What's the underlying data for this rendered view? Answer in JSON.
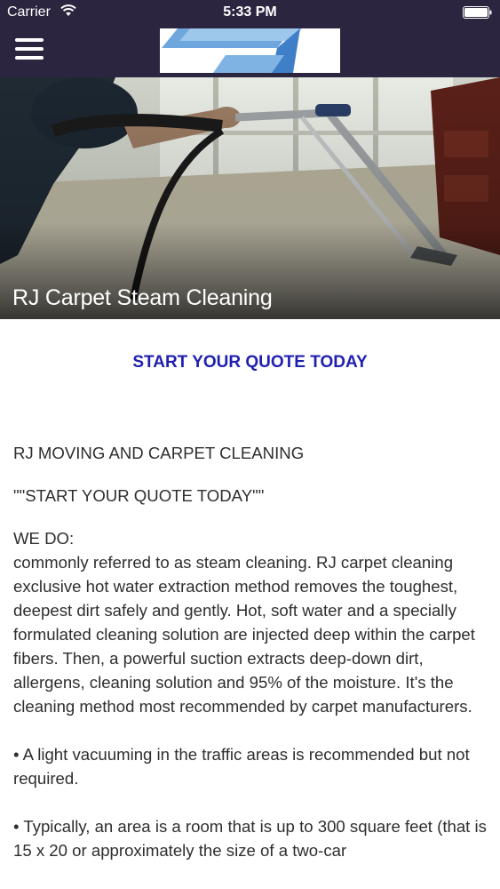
{
  "status_bar": {
    "carrier": "Carrier",
    "time": "5:33 PM"
  },
  "header": {
    "menu_icon": "hamburger-menu-icon",
    "logo": "company-logo",
    "background_color": "#2c2540"
  },
  "hero": {
    "title": "RJ Carpet Steam Cleaning"
  },
  "cta": {
    "label": "START YOUR QUOTE TODAY",
    "color": "#2020b0"
  },
  "content": {
    "company_name": "RJ MOVING AND CARPET CLEANING",
    "quote_line": "\"\"START YOUR QUOTE TODAY\"\"",
    "we_do_heading": "WE DO:",
    "description": "commonly referred to as steam cleaning. RJ carpet cleaning exclusive hot water extraction method removes the toughest, deepest dirt safely and gently. Hot, soft water and a specially formulated cleaning solution are injected deep within the carpet fibers. Then, a powerful suction extracts deep-down dirt, allergens, cleaning solution and 95% of the moisture. It's the cleaning method most recommended by carpet manufacturers.",
    "bullet_1": "• A light vacuuming in the traffic areas is recommended but not required.",
    "bullet_2": "• Typically, an area is a room that is up to 300 square feet (that is 15 x 20 or approximately the size of a two-car"
  }
}
